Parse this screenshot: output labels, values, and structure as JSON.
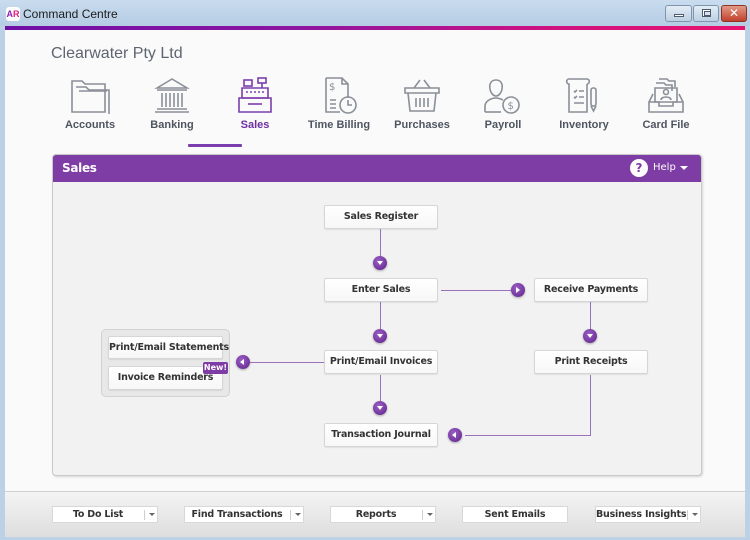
{
  "window": {
    "app_icon": "AR",
    "title": "Command Centre",
    "controls": [
      "minimize",
      "maximize",
      "close"
    ]
  },
  "company_name": "Clearwater Pty Ltd",
  "nav": {
    "active": "Sales",
    "items": [
      {
        "label": "Accounts",
        "icon": "folder-icon"
      },
      {
        "label": "Banking",
        "icon": "bank-icon"
      },
      {
        "label": "Sales",
        "icon": "cash-register-icon"
      },
      {
        "label": "Time Billing",
        "icon": "time-billing-icon"
      },
      {
        "label": "Purchases",
        "icon": "basket-icon"
      },
      {
        "label": "Payroll",
        "icon": "person-dollar-icon"
      },
      {
        "label": "Inventory",
        "icon": "inventory-icon"
      },
      {
        "label": "Card File",
        "icon": "card-file-icon"
      }
    ]
  },
  "panel": {
    "title": "Sales",
    "help_icon": "?",
    "help_label": "Help",
    "accent_color": "#7e3ca5"
  },
  "flow": {
    "sales_register": "Sales Register",
    "enter_sales": "Enter Sales",
    "receive_payments": "Receive Payments",
    "print_email_invoices": "Print/Email Invoices",
    "print_receipts": "Print Receipts",
    "transaction_journal": "Transaction Journal",
    "print_email_statements": "Print/Email Statements",
    "invoice_reminders": "Invoice Reminders",
    "new_badge": "New!"
  },
  "footer": {
    "buttons": [
      {
        "label": "To Do List",
        "has_dropdown": true
      },
      {
        "label": "Find Transactions",
        "has_dropdown": true
      },
      {
        "label": "Reports",
        "has_dropdown": true
      },
      {
        "label": "Sent Emails",
        "has_dropdown": false
      },
      {
        "label": "Business Insights",
        "has_dropdown": true
      }
    ]
  }
}
